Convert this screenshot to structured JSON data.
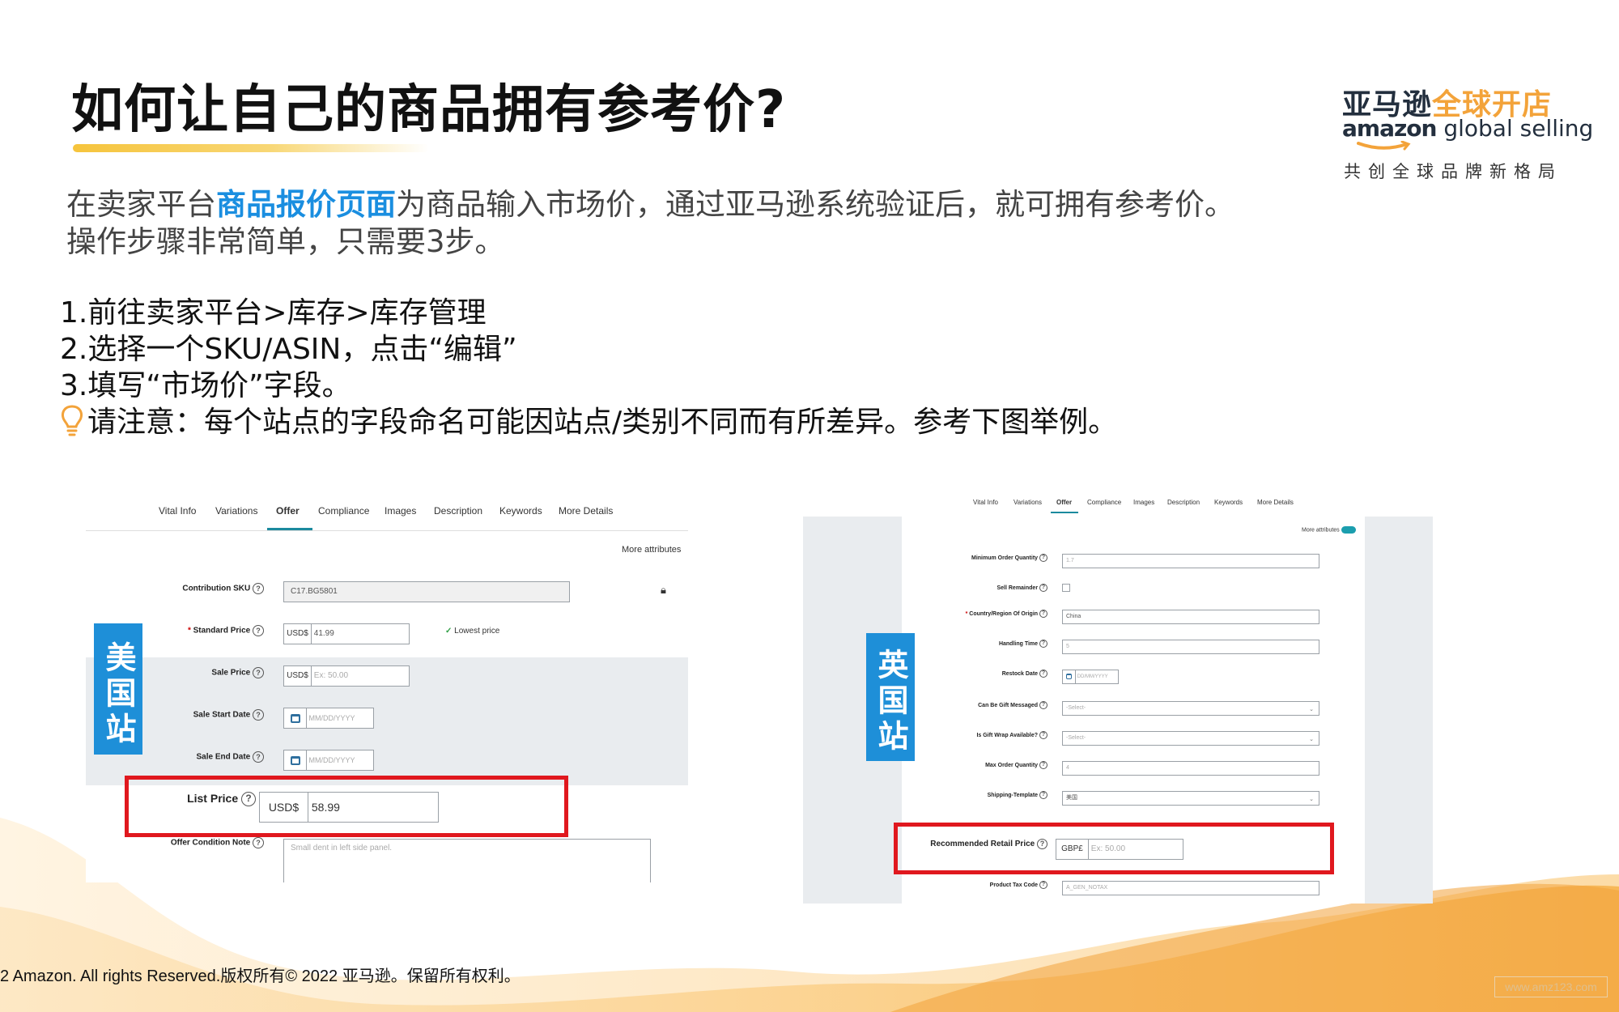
{
  "slide": {
    "title": "如何让自己的商品拥有参考价?",
    "logo": {
      "cn_part1": "亚马逊",
      "cn_part2": "全球开店",
      "en_brand": "amazon",
      "en_suffix": " global selling",
      "tagline": "共创全球品牌新格局",
      "colors": {
        "navy": "#232f3e",
        "orange": "#f3a33a"
      }
    },
    "intro": {
      "before": "在卖家平台",
      "highlight": "商品报价页面",
      "after": "为商品输入市场价，通过亚马逊系统验证后，就可拥有参考价。",
      "line2": "操作步骤非常简单，只需要3步。",
      "highlight_color": "#1a8ee0"
    },
    "steps": [
      "1.前往卖家平台>库存>库存管理",
      "2.选择一个SKU/ASIN，点击“编辑”",
      "3.填写“市场价”字段。"
    ],
    "note": "请注意：每个站点的字段命名可能因站点/类别不同而有所差异。参考下图举例。",
    "note_icon": "lightbulb-icon",
    "copyright": "2 Amazon. All rights Reserved.版权所有© 2022 亚马逊。保留所有权利。",
    "watermark": "www.amz123.com"
  },
  "us_panel": {
    "station_label": "美国站",
    "tabs": [
      "Vital Info",
      "Variations",
      "Offer",
      "Compliance",
      "Images",
      "Description",
      "Keywords",
      "More Details"
    ],
    "active_tab": "Offer",
    "more_attributes": "More attributes",
    "fields": {
      "contribution_sku": {
        "label": "Contribution SKU",
        "value": "C17.BG5801"
      },
      "standard_price": {
        "label": "Standard Price",
        "currency": "USD$",
        "value": "41.99",
        "badge": "Lowest price"
      },
      "sale_price": {
        "label": "Sale Price",
        "currency": "USD$",
        "placeholder": "Ex: 50.00"
      },
      "sale_start_date": {
        "label": "Sale Start Date",
        "placeholder": "MM/DD/YYYY"
      },
      "sale_end_date": {
        "label": "Sale End Date",
        "placeholder": "MM/DD/YYYY"
      },
      "list_price": {
        "label": "List Price",
        "currency": "USD$",
        "value": "58.99"
      },
      "offer_condition_note": {
        "label": "Offer Condition Note",
        "placeholder": "Small dent in left side panel."
      }
    }
  },
  "uk_panel": {
    "station_label": "英国站",
    "tabs": [
      "Vital Info",
      "Variations",
      "Offer",
      "Compliance",
      "Images",
      "Description",
      "Keywords",
      "More Details"
    ],
    "active_tab": "Offer",
    "more_attributes": "More attributes",
    "fields": {
      "min_order_qty": {
        "label": "Minimum Order Quantity",
        "value": "1.7"
      },
      "sell_remainder": {
        "label": "Sell Remainder"
      },
      "country_origin": {
        "label": "Country/Region Of Origin",
        "value": "China"
      },
      "handling_time": {
        "label": "Handling Time",
        "value": "5"
      },
      "restock_date": {
        "label": "Restock Date",
        "placeholder": "DD/MM/YYYY"
      },
      "gift_messaged": {
        "label": "Can Be Gift Messaged",
        "value": "-Select-"
      },
      "gift_wrap": {
        "label": "Is Gift Wrap Available?",
        "value": "-Select-"
      },
      "max_order_qty": {
        "label": "Max Order Quantity",
        "value": "4"
      },
      "shipping_template": {
        "label": "Shipping-Template",
        "value": "美国"
      },
      "recommended_retail_price": {
        "label": "Recommended Retail Price",
        "currency": "GBP£",
        "placeholder": "Ex: 50.00"
      },
      "product_tax_code": {
        "label": "Product Tax Code",
        "value": "A_GEN_NOTAX"
      }
    }
  }
}
